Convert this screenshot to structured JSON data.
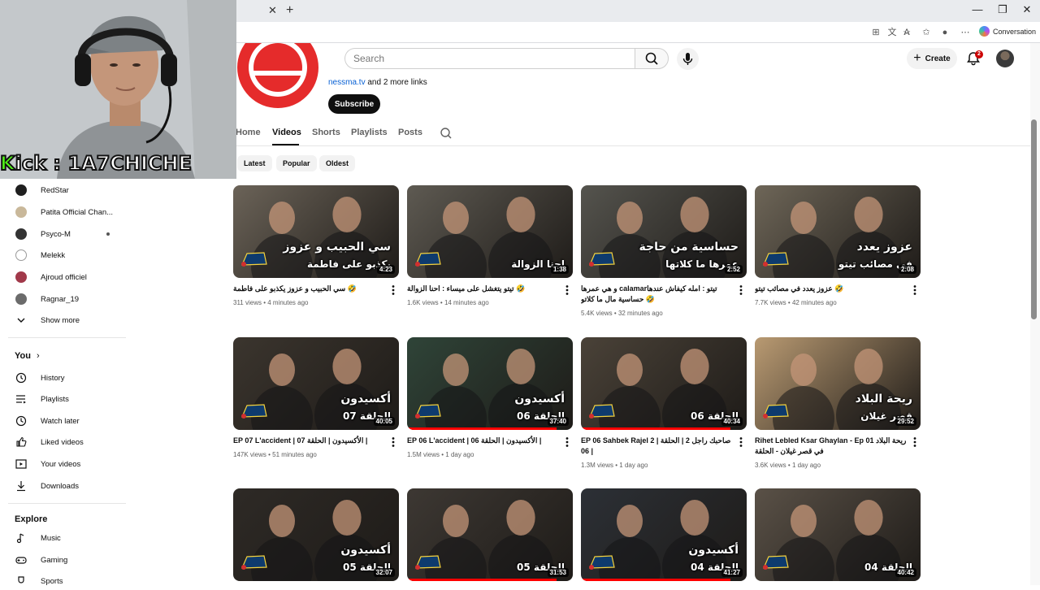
{
  "browser": {
    "conversation_label": "Conversation"
  },
  "header": {
    "search_placeholder": "Search",
    "create_label": "Create",
    "notification_count": "2"
  },
  "channel": {
    "links_url": "nessma.tv",
    "links_more": " and 2 more links",
    "subscribe_label": "Subscribe",
    "tabs": [
      "Home",
      "Videos",
      "Shorts",
      "Playlists",
      "Posts"
    ],
    "active_tab": "Videos",
    "chips": [
      "Latest",
      "Popular",
      "Oldest"
    ]
  },
  "overlay": {
    "kick_prefix": "K",
    "kick_rest": "ick : 1A7CHICHE"
  },
  "sidebar": {
    "subscriptions": [
      {
        "name": "RedStar",
        "color": "#1f1f1f"
      },
      {
        "name": "Patita Official Chan...",
        "color": "#c9b89a"
      },
      {
        "name": "Psyco-M",
        "color": "#333333"
      },
      {
        "name": "Melekk",
        "color": "#ffffff"
      },
      {
        "name": "Ajroud officiel",
        "color": "#a1394a"
      },
      {
        "name": "Ragnar_19",
        "color": "#6b6b6b"
      }
    ],
    "show_more_label": "Show more",
    "you_heading": "You",
    "you_items": [
      "History",
      "Playlists",
      "Watch later",
      "Liked videos",
      "Your videos",
      "Downloads"
    ],
    "explore_heading": "Explore",
    "explore_items": [
      "Music",
      "Gaming",
      "Sports"
    ]
  },
  "videos": [
    {
      "title": "سي الحبيب و عزوز يكذبو على فاطمة 🤣",
      "views": "311 views",
      "age": "4 minutes ago",
      "duration": "4:23",
      "overlay1": "سي الحبيب و عزوز",
      "overlay2": "يكذبو على فاطمة",
      "bg": "#6b6358",
      "progress": 0
    },
    {
      "title": "تيتو يتغشل على ميساء : احنا الزوالة 🤣",
      "views": "1.6K views",
      "age": "14 minutes ago",
      "duration": "1:38",
      "overlay1": "",
      "overlay2": "احنا الزوالة",
      "bg": "#5e5a52",
      "progress": 0
    },
    {
      "title": "و هي عمرها calamarتيتو : امله كيفاش عندها حساسية مال ما كلاتو 🤣",
      "views": "5.4K views",
      "age": "32 minutes ago",
      "duration": "2:52",
      "overlay1": "حساسية من حاجة",
      "overlay2": "عمرها ما كلاتها",
      "bg": "#55544e",
      "progress": 0
    },
    {
      "title": "عزوز يعدد في مصائب تيتو 🤣",
      "views": "7.7K views",
      "age": "42 minutes ago",
      "duration": "2:08",
      "overlay1": "عزوز يعدد",
      "overlay2": "في مصائب تيتو",
      "bg": "#6e6658",
      "progress": 0
    },
    {
      "title": "EP 07 L'accident | الأكسيدون | الحلقة 07 |",
      "views": "147K views",
      "age": "51 minutes ago",
      "duration": "40:05",
      "overlay1": "أكسيدون",
      "overlay2": "الحلقة 07",
      "bg": "#3b352e",
      "progress": 0
    },
    {
      "title": "EP 06 L'accident | الأكسيدون | الحلقة 06 |",
      "views": "1.5M views",
      "age": "1 day ago",
      "duration": "37:40",
      "overlay1": "أكسيدون",
      "overlay2": "الحلقة 06",
      "bg": "#2f4438",
      "progress": 0.9
    },
    {
      "title": "EP 06 Sahbek Rajel 2 | صاحبك راجل 2 | الحلقة 06 |",
      "views": "1.3M views",
      "age": "1 day ago",
      "duration": "40:34",
      "overlay1": "",
      "overlay2": "الحلقة 06",
      "bg": "#4a4238",
      "progress": 0.9
    },
    {
      "title": "Rihet Lebled Ksar Ghaylan - Ep 01 ريحة البلاد في قصر غيلان - الحلقة",
      "views": "3.6K views",
      "age": "1 day ago",
      "duration": "29:52",
      "overlay1": "ريحة البلاد",
      "overlay2": "قصر غيلان",
      "bg": "#b99a72",
      "progress": 0
    },
    {
      "title": "",
      "views": "",
      "age": "",
      "duration": "32:07",
      "overlay1": "أكسيدون",
      "overlay2": "الحلقة 05",
      "bg": "#2e2a26",
      "progress": 0
    },
    {
      "title": "",
      "views": "",
      "age": "",
      "duration": "31:53",
      "overlay1": "",
      "overlay2": "الحلقة 05",
      "bg": "#3d3833",
      "progress": 0.9
    },
    {
      "title": "",
      "views": "",
      "age": "",
      "duration": "41:27",
      "overlay1": "أكسيدون",
      "overlay2": "الحلقة 04",
      "bg": "#2c3036",
      "progress": 0.9
    },
    {
      "title": "",
      "views": "",
      "age": "",
      "duration": "40:42",
      "overlay1": "",
      "overlay2": "الحلقة 04",
      "bg": "#5a5147",
      "progress": 0
    }
  ]
}
